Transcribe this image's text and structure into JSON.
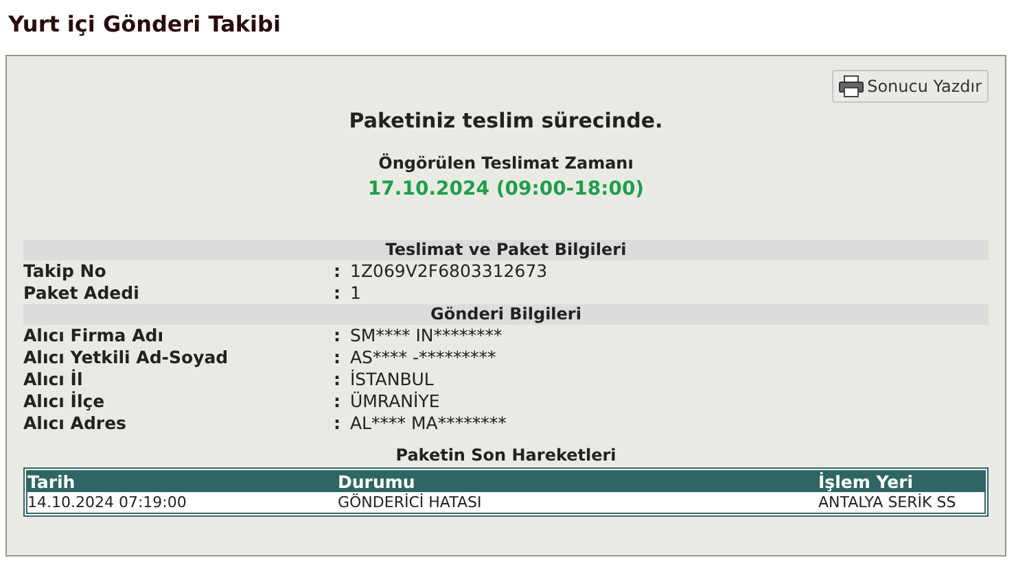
{
  "page_title": "Yurt içi Gönderi Takibi",
  "print_button": {
    "label": "Sonucu Yazdır"
  },
  "status_message": "Paketiniz teslim sürecinde.",
  "estimated_delivery": {
    "label": "Öngörülen Teslimat Zamanı",
    "value": "17.10.2024 (09:00-18:00)"
  },
  "sections": [
    {
      "title": "Teslimat ve Paket Bilgileri",
      "rows": [
        {
          "label": "Takip No",
          "separator": ":",
          "value": "1Z069V2F6803312673"
        },
        {
          "label": "Paket Adedi",
          "separator": ":",
          "value": "1"
        }
      ]
    },
    {
      "title": "Gönderi Bilgileri",
      "rows": [
        {
          "label": "Alıcı Firma Adı",
          "separator": ":",
          "value": "SM**** IN********"
        },
        {
          "label": "Alıcı Yetkili Ad-Soyad",
          "separator": ":",
          "value": "AS**** -*********"
        },
        {
          "label": "Alıcı İl",
          "separator": ":",
          "value": "İSTANBUL"
        },
        {
          "label": "Alıcı İlçe",
          "separator": ":",
          "value": "ÜMRANİYE"
        },
        {
          "label": "Alıcı Adres",
          "separator": ":",
          "value": "AL**** MA********"
        }
      ]
    }
  ],
  "movements": {
    "title": "Paketin Son Hareketleri",
    "columns": [
      "Tarih",
      "Durumu",
      "İşlem Yeri"
    ],
    "rows": [
      [
        "14.10.2024 07:19:00",
        "GÖNDERİCİ HATASI",
        "ANTALYA SERİK SS"
      ]
    ]
  }
}
